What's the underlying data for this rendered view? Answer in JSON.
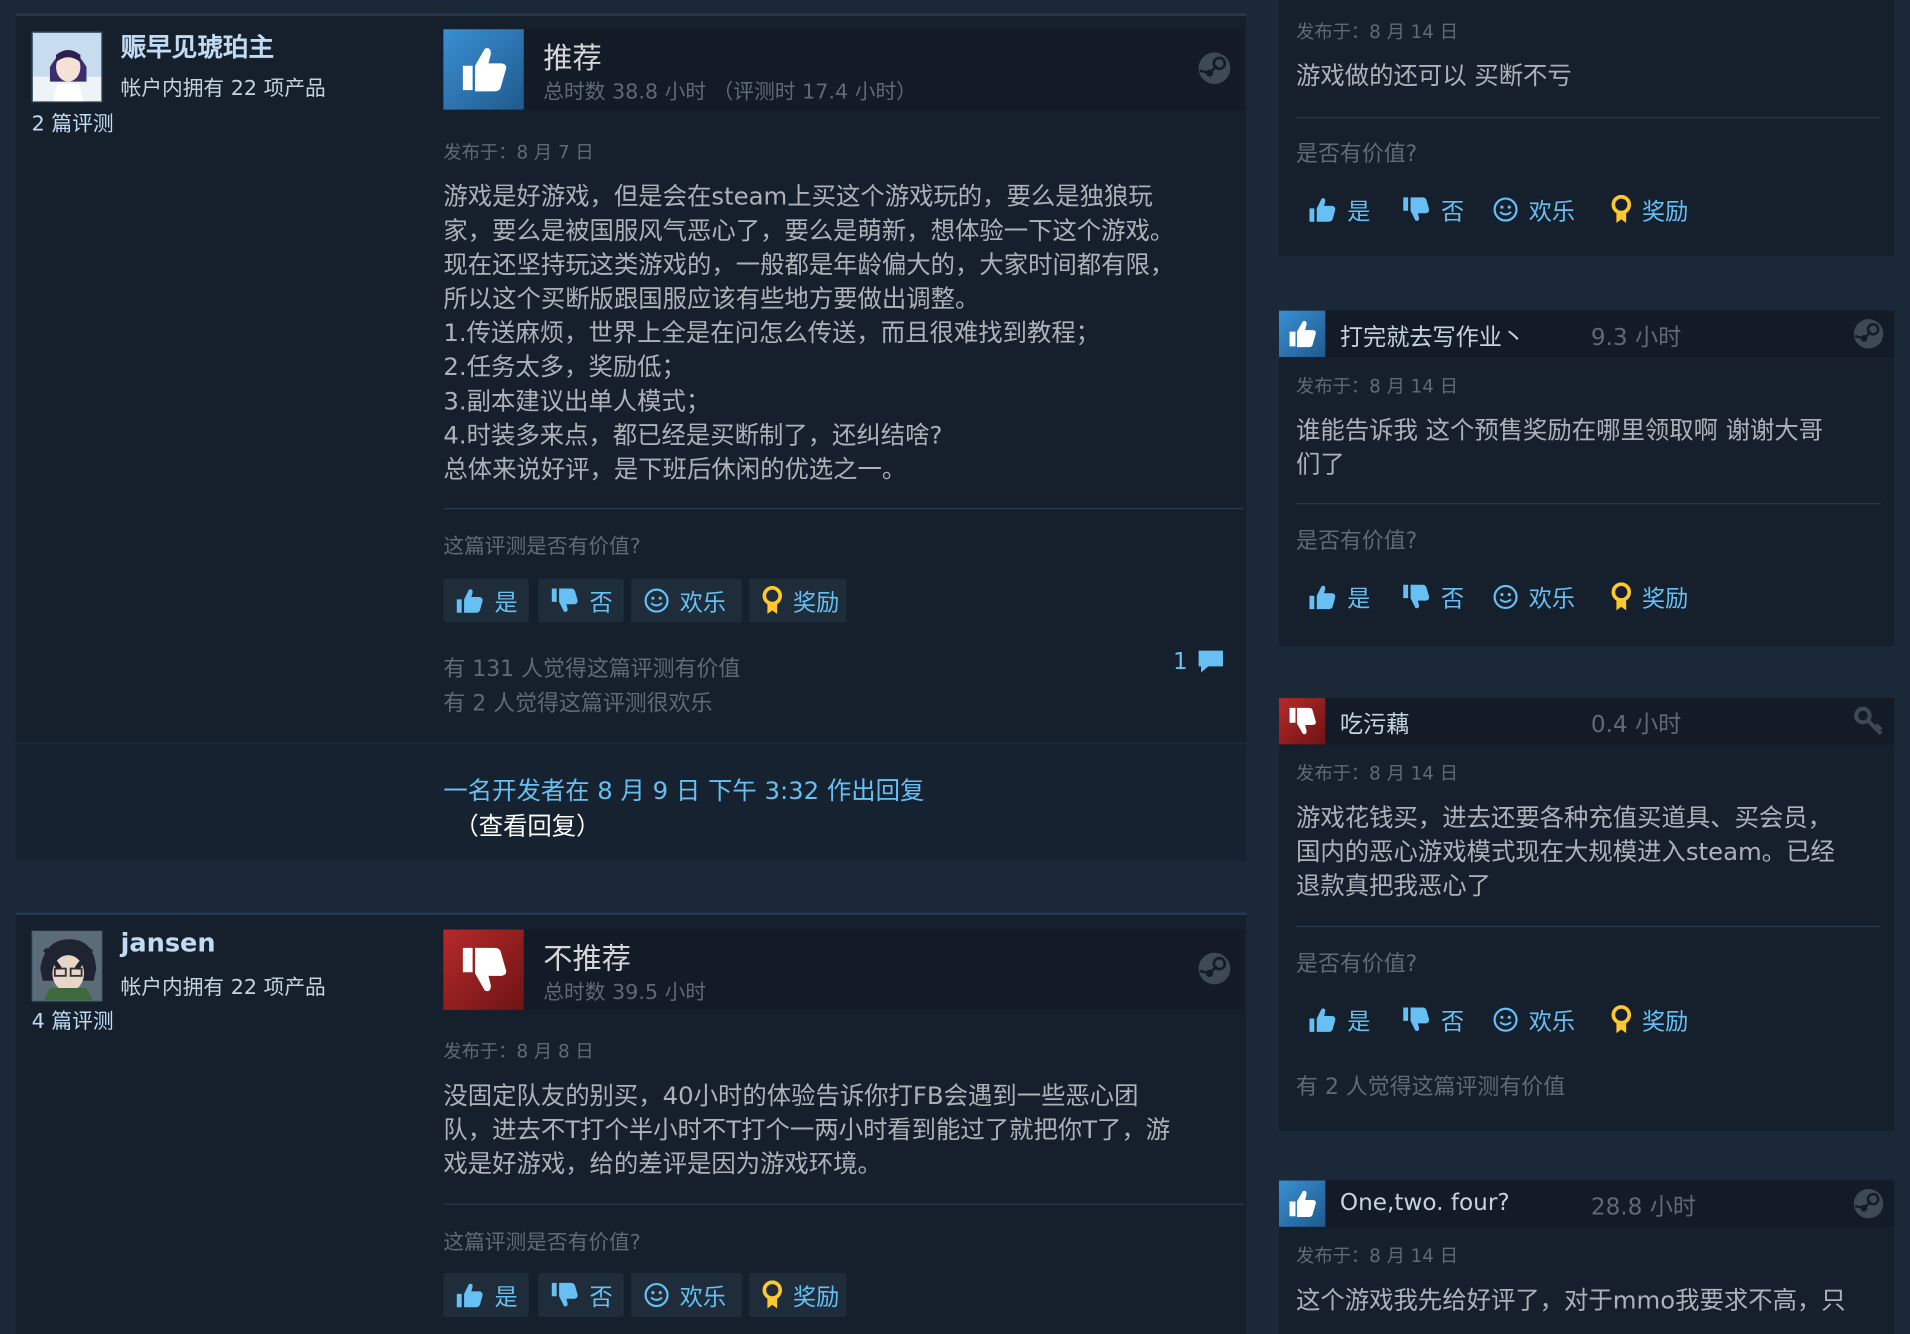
{
  "colors": {
    "background": "#1b2838",
    "card": "#16202d",
    "link": "#66c0f4",
    "muted": "#5e6a75",
    "text": "#acb2b8",
    "recommend": "#3a8fd4",
    "not_recommend": "#b52a2a",
    "award": "#ffc82c"
  },
  "vote_labels": {
    "yes": "是",
    "no": "否",
    "funny": "欢乐",
    "award": "奖励"
  },
  "reviews": [
    {
      "author": {
        "name": "赈早见琥珀主",
        "owned": "帐户内拥有 22 项产品",
        "review_count": "2 篇评测"
      },
      "verdict": "推荐",
      "hours": "总时数 38.8 小时 （评测时 17.4 小时）",
      "posted": "发布于：8 月 7 日",
      "body": [
        "游戏是好游戏，但是会在steam上买这个游戏玩的，要么是独狼玩",
        "家，要么是被国服风气恶心了，要么是萌新，想体验一下这个游戏。",
        "现在还坚持玩这类游戏的，一般都是年龄偏大的，大家时间都有限，",
        "所以这个买断版跟国服应该有些地方要做出调整。",
        "1.传送麻烦，世界上全是在问怎么传送，而且很难找到教程；",
        "2.任务太多，奖励低；",
        "3.副本建议出单人模式；",
        "4.时装多来点，都已经是买断制了，还纠结啥?",
        "总体来说好评，是下班后休闲的优选之一。"
      ],
      "helpful_question": "这篇评测是否有价值?",
      "helpful_count": "有 131 人觉得这篇评测有价值",
      "funny_count": "有 2 人觉得这篇评测很欢乐",
      "comment_count": "1",
      "dev_reply": "一名开发者在 8 月 9 日 下午 3:32 作出回复",
      "view_reply": "（查看回复）"
    },
    {
      "author": {
        "name": "jansen",
        "owned": "帐户内拥有 22 项产品",
        "review_count": "4 篇评测"
      },
      "verdict": "不推荐",
      "hours": "总时数 39.5 小时",
      "posted": "发布于：8 月 8 日",
      "body": [
        "没固定队友的别买，40小时的体验告诉你打FB会遇到一些恶心团",
        "队，进去不T打个半小时不T打个一两小时看到能过了就把你T了，游",
        "戏是好游戏，给的差评是因为游戏环境。"
      ],
      "helpful_question": "这篇评测是否有价值?"
    }
  ],
  "side_reviews": [
    {
      "posted": "发布于：8 月 14 日",
      "body": [
        "游戏做的还可以 买断不亏"
      ],
      "helpful_question": "是否有价值?"
    },
    {
      "name": "打完就去写作业丶",
      "hours": "9.3 小时",
      "recommended": true,
      "posted": "发布于：8 月 14 日",
      "body": [
        "谁能告诉我 这个预售奖励在哪里领取啊 谢谢大哥",
        "们了"
      ],
      "helpful_question": "是否有价值?"
    },
    {
      "name": "吃污藕",
      "hours": "0.4 小时",
      "recommended": false,
      "posted": "发布于：8 月 14 日",
      "body": [
        "游戏花钱买，进去还要各种充值买道具、买会员，",
        "国内的恶心游戏模式现在大规模进入steam。已经",
        "退款真把我恶心了"
      ],
      "helpful_question": "是否有价值?",
      "helpful_count": "有 2 人觉得这篇评测有价值"
    },
    {
      "name": "One,two. four?",
      "hours": "28.8 小时",
      "recommended": true,
      "posted": "发布于：8 月 14 日",
      "body": [
        "这个游戏我先给好评了，对于mmo我要求不高，只"
      ]
    }
  ]
}
